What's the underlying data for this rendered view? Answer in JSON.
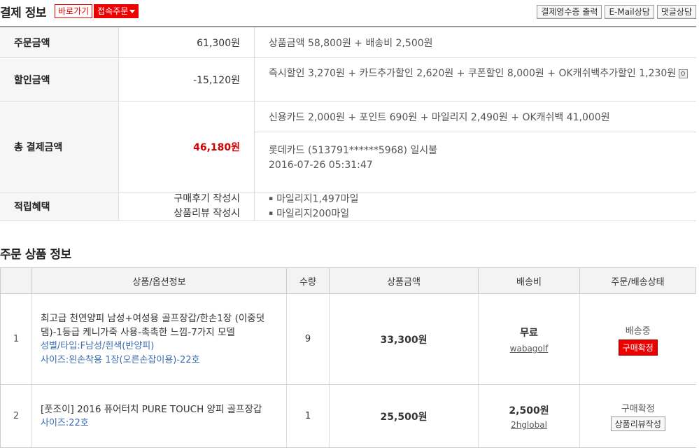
{
  "payment": {
    "title": "결제 정보",
    "go_button": "바로가기",
    "order_button": "접속주문",
    "actions": [
      "결제영수증 출력",
      "E-Mail상담",
      "댓글상담"
    ],
    "rows": {
      "order_amount": {
        "label": "주문금액",
        "value": "61,300원",
        "detail": "상품금액 58,800원 + 배송비 2,500원"
      },
      "discount": {
        "label": "할인금액",
        "value": "-15,120원",
        "detail": "즉시할인 3,270원 + 카드추가할인 2,620원 + 쿠폰할인 8,000원 + OK캐쉬백추가할인 1,230원"
      },
      "total": {
        "label": "총 결제금액",
        "value": "46,180원",
        "detail1": "신용카드 2,000원 + 포인트 690원 + 마일리지 2,490원 + OK캐쉬백 41,000원",
        "detail2_line1": "롯데카드 (513791******5968) 일시불",
        "detail2_line2": "2016-07-26 05:31:47"
      },
      "reward": {
        "label": "적립혜택",
        "cond1": "구매후기 작성시",
        "cond2": "상품리뷰 작성시",
        "item1": "마일리지1,497마일",
        "item2": "마일리지200마일"
      }
    }
  },
  "order": {
    "title": "주문 상품 정보",
    "columns": [
      "상품/옵션정보",
      "수량",
      "상품금액",
      "배송비",
      "주문/배송상태"
    ],
    "items": [
      {
        "no": "1",
        "name": "최고급 천연양피 남성+여성용 골프장갑/한손1장 (이중덧댐)-1등급 케니가죽 사용-촉촉한 느낌-7가지 모델",
        "opt1": "성별/타입:F남성/흰색(반양피)",
        "opt2": "사이즈:왼손착용 1장(오른손잡이용)-22호",
        "qty": "9",
        "price": "33,300원",
        "shipping": "무료",
        "seller": "wabagolf",
        "status": "배송중",
        "status_button": "구매확정"
      },
      {
        "no": "2",
        "name": "[풋조이] 2016 퓨어터치 PURE TOUCH 양피 골프장갑",
        "opt1": "사이즈:22호",
        "qty": "1",
        "price": "25,500원",
        "shipping": "2,500원",
        "seller": "2hglobal",
        "status": "구매확정",
        "status_button": "상품리뷰작성"
      }
    ]
  }
}
